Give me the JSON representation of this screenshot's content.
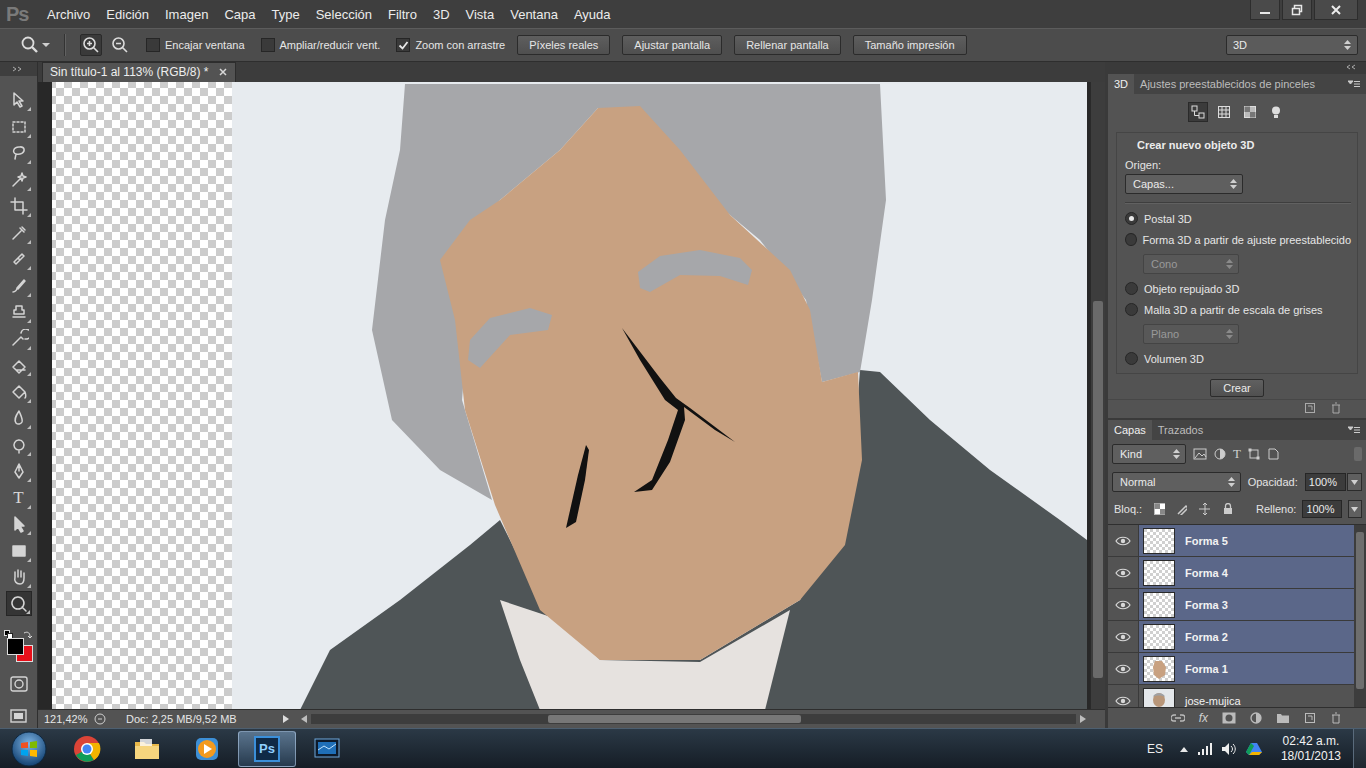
{
  "app": {
    "logo": "Ps"
  },
  "menu": [
    "Archivo",
    "Edición",
    "Imagen",
    "Capa",
    "Type",
    "Selección",
    "Filtro",
    "3D",
    "Vista",
    "Ventana",
    "Ayuda"
  ],
  "options_bar": {
    "checkboxes": [
      {
        "label": "Encajar ventana",
        "checked": false
      },
      {
        "label": "Ampliar/reducir vent.",
        "checked": false
      },
      {
        "label": "Zoom con arrastre",
        "checked": true
      }
    ],
    "buttons": [
      "Píxeles reales",
      "Ajustar pantalla",
      "Rellenar pantalla",
      "Tamaño impresión"
    ],
    "workspace": "3D"
  },
  "tools": [
    {
      "selected": false
    },
    {
      "selected": false
    },
    {
      "selected": false
    },
    {
      "selected": false
    },
    {
      "selected": false
    },
    {
      "selected": false
    },
    {
      "selected": false
    },
    {
      "selected": false
    },
    {
      "selected": false
    },
    {
      "selected": false
    },
    {
      "selected": false
    },
    {
      "selected": false
    },
    {
      "selected": false
    },
    {
      "selected": false
    },
    {
      "selected": false
    },
    {
      "selected": false,
      "text": "T"
    },
    {
      "selected": false
    },
    {
      "selected": false
    },
    {
      "selected": false
    },
    {
      "selected": true
    }
  ],
  "colors": {
    "foreground": "#000000",
    "background": "#e8101a"
  },
  "document": {
    "tab_title": "Sin título-1 al 113% (RGB/8) *",
    "zoom": "121,42%",
    "doc_size": "Doc: 2,25 MB/9,52 MB"
  },
  "scrollbars": {
    "canvas_vertical": {
      "start": 0.35,
      "size": 0.6
    },
    "canvas_horizontal": {
      "start": 0.31,
      "size": 0.33
    },
    "layers_vertical": {
      "start": 0.04,
      "size": 0.86
    }
  },
  "panel_3d": {
    "tabs": [
      {
        "label": "3D",
        "selected": true
      },
      {
        "label": "Ajustes preestablecidos de pinceles",
        "selected": false
      }
    ],
    "view_buttons": [
      {
        "selected": true
      },
      {
        "selected": false
      },
      {
        "selected": false
      },
      {
        "selected": false
      }
    ],
    "title": "Crear nuevo objeto 3D",
    "source_label": "Origen:",
    "source_value": "Capas...",
    "options": [
      {
        "kind": "radio",
        "label": "Postal 3D",
        "selected": true,
        "disabled": false
      },
      {
        "kind": "radio",
        "label": "Forma 3D a partir de ajuste preestablecido",
        "selected": false,
        "disabled": false
      },
      {
        "kind": "select",
        "label": "Cono",
        "selected": false,
        "disabled": true
      },
      {
        "kind": "radio",
        "label": "Objeto repujado 3D",
        "selected": false,
        "disabled": false
      },
      {
        "kind": "radio",
        "label": "Malla 3D a partir de escala de grises",
        "selected": false,
        "disabled": false
      },
      {
        "kind": "select",
        "label": "Plano",
        "selected": false,
        "disabled": true
      },
      {
        "kind": "radio",
        "label": "Volumen 3D",
        "selected": false,
        "disabled": false
      }
    ],
    "create_button": "Crear"
  },
  "layers_panel": {
    "tabs": [
      {
        "label": "Capas",
        "selected": true
      },
      {
        "label": "Trazados",
        "selected": false
      }
    ],
    "filter": "Kind",
    "filter_type_glyph": "T",
    "blend_mode": "Normal",
    "opacity_label": "Opacidad:",
    "opacity": "100%",
    "lock_label": "Bloq.:",
    "fill_label": "Relleno:",
    "fill": "100%",
    "footer_fx": "fx",
    "layers": [
      {
        "name": "Forma 5",
        "visible": true,
        "selected": true,
        "kind": "transparent"
      },
      {
        "name": "Forma 4",
        "visible": true,
        "selected": true,
        "kind": "transparent"
      },
      {
        "name": "Forma 3",
        "visible": true,
        "selected": true,
        "kind": "transparent"
      },
      {
        "name": "Forma 2",
        "visible": true,
        "selected": true,
        "kind": "transparent"
      },
      {
        "name": "Forma 1",
        "visible": true,
        "selected": true,
        "kind": "fill"
      },
      {
        "name": "jose-mujica",
        "visible": true,
        "selected": false,
        "kind": "photo"
      }
    ]
  },
  "taskbar": {
    "apps": [
      {
        "kind": "chrome",
        "selected": false
      },
      {
        "kind": "explorer",
        "selected": false
      },
      {
        "kind": "media",
        "selected": false
      },
      {
        "kind": "photoshop",
        "selected": true,
        "text": "Ps"
      },
      {
        "kind": "screen",
        "selected": false
      }
    ],
    "language": "ES",
    "time": "02:42 a.m.",
    "date": "18/01/2013"
  }
}
